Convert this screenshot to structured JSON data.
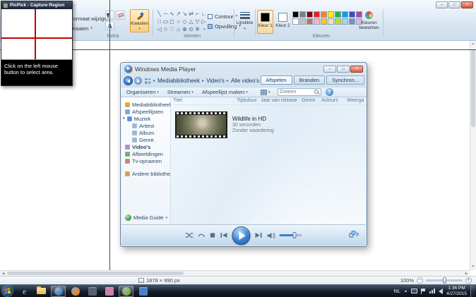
{
  "glyphs": {
    "minimize": "–",
    "maximize": "□",
    "close": "×",
    "caret": "▾",
    "crumb_sep": "▸",
    "tray_chevron": "▲",
    "minus": "−",
    "plus": "+",
    "scroll_up": "▲",
    "scroll_down": "▼",
    "scroll_left": "◀",
    "scroll_right": "▶",
    "help": "?"
  },
  "ribbon": {
    "extra_group": {
      "label": "Extra",
      "resize_label": "Formaat wijzigen",
      "rotate_label": "Draaien"
    },
    "tools_group": {
      "text_label": "A",
      "brush_label": "Kwasten"
    },
    "shapes_group": {
      "label": "Vormen",
      "contour_label": "Contour",
      "fill_label": "Opvulling",
      "shapes": [
        "╲",
        "─",
        "∿",
        "↗",
        "↘",
        "⇄",
        "⌐",
        "∟",
        "□",
        "▭",
        "◻",
        "○",
        "◇",
        "△",
        "▽",
        "▷",
        "◁",
        "☆",
        "♡",
        "⌂",
        "⊕",
        "⊙",
        "※",
        "◔"
      ]
    },
    "line_group": {
      "label": "Lijndikte"
    },
    "colors_group": {
      "label": "Kleuren",
      "color1_label": "Kleur 1",
      "color2_label": "Kleur 2",
      "color1": "#000000",
      "color2": "#ffffff",
      "edit_label": "Kleuren bewerken",
      "palette": [
        "#000000",
        "#7f7f7f",
        "#880015",
        "#ed1c24",
        "#ff7f27",
        "#fff200",
        "#22b14c",
        "#00a2e8",
        "#3f48cc",
        "#a349a4",
        "#ffffff",
        "#c3c3c3",
        "#b97a57",
        "#ffaec9",
        "#ffc90e",
        "#efe4b0",
        "#b5e61d",
        "#99d9ea",
        "#7092be",
        "#c8bfe7"
      ]
    }
  },
  "capture_window": {
    "title": "PicPick - Capture Region",
    "tooltip": "Click on the left mouse button to select area.",
    "crosshair_color": "#c40000"
  },
  "wmp": {
    "title": "Windows Media Player",
    "breadcrumb": [
      "Mediabibliotheek",
      "Video's",
      "Alle video's"
    ],
    "tabs": [
      {
        "label": "Afspelen",
        "active": true
      },
      {
        "label": "Branden",
        "active": false
      },
      {
        "label": "Synchron...",
        "active": false
      }
    ],
    "menus": [
      "Organiseren",
      "Streamen",
      "Afspeellijst maken"
    ],
    "search_placeholder": "Zoeken",
    "columns": [
      "Titel",
      "Tijdsduur",
      "Jaar van release",
      "Genre",
      "Acteurs",
      "Weerga"
    ],
    "sidebar": [
      {
        "label": "Mediabibliotheek",
        "icon": "library-icon",
        "indent": 0,
        "color": "#e8a33d"
      },
      {
        "label": "Afspeellijsten",
        "icon": "playlist-icon",
        "indent": 0,
        "color": "#7ba7d7"
      },
      {
        "label": "Muziek",
        "icon": "music-icon",
        "indent": 0,
        "color": "#5a8fd3",
        "arrow": "▾"
      },
      {
        "label": "Artiest",
        "icon": "artist-icon",
        "indent": 1,
        "color": "#9bb7d4"
      },
      {
        "label": "Album",
        "icon": "album-icon",
        "indent": 1,
        "color": "#9bb7d4"
      },
      {
        "label": "Genre",
        "icon": "genre-icon",
        "indent": 1,
        "color": "#9bb7d4"
      },
      {
        "label": "Video's",
        "icon": "videos-icon",
        "indent": 0,
        "color": "#b08cc9",
        "selected": true
      },
      {
        "label": "Afbeeldingen",
        "icon": "pictures-icon",
        "indent": 0,
        "color": "#6fae6f"
      },
      {
        "label": "Tv-opnamen",
        "icon": "tv-icon",
        "indent": 0,
        "color": "#d07f7f"
      },
      {
        "label": "Andere bibliotheken",
        "icon": "other-libraries-icon",
        "indent": 0,
        "color": "#c9a35a",
        "gap": true
      }
    ],
    "media_guide_label": "Media Guide",
    "item": {
      "title": "Wildlife in HD",
      "duration": "30 seconden",
      "rating": "Zonder waardering"
    }
  },
  "statusbar": {
    "size_text": "1878 × 990 px",
    "zoom_text": "100%"
  },
  "taskbar": {
    "tray_language": "NL",
    "time": "1:36 PM",
    "date": "4/27/2015",
    "icons": [
      {
        "name": "ie-icon",
        "type": "letter",
        "glyph": "e",
        "color": "#4fb4e8",
        "active": false
      },
      {
        "name": "explorer-folder-icon",
        "type": "folder",
        "color": "#f0c75a",
        "active": false
      },
      {
        "name": "wmp-icon",
        "type": "circle",
        "color": "#2f7fd0",
        "active": true
      },
      {
        "name": "firefox-icon",
        "type": "circle",
        "color": "#e8822a",
        "active": false
      },
      {
        "name": "taskbar-app-icon-1",
        "type": "square",
        "color": "#55606e",
        "active": false
      },
      {
        "name": "paint-icon",
        "type": "square",
        "color": "#cf7fa8",
        "active": false
      },
      {
        "name": "picpick-icon",
        "type": "circle",
        "color": "#74b53e",
        "active": true
      },
      {
        "name": "taskbar-app-icon-2",
        "type": "square",
        "color": "#4a7fc9",
        "active": false
      }
    ]
  }
}
